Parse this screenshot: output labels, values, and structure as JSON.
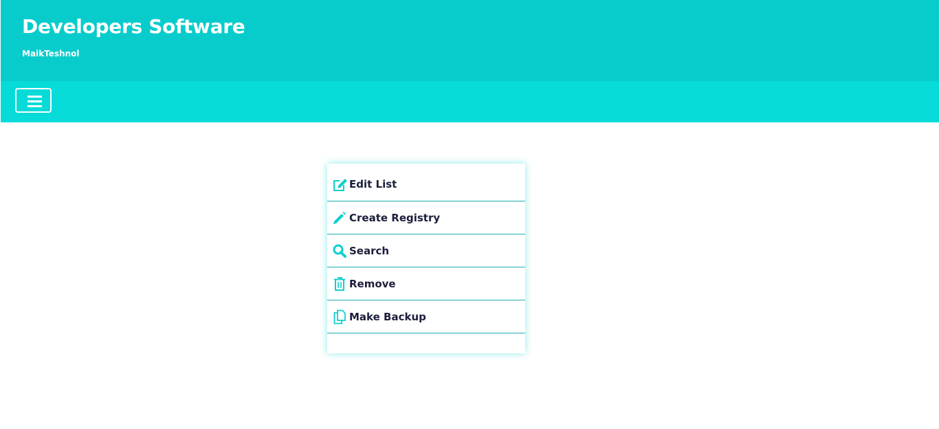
{
  "header": {
    "title": "Developers Software",
    "subtitle": "MaikTeshnol"
  },
  "navbar": {
    "menu_toggle_icon": "hamburger-icon"
  },
  "menu": {
    "items": [
      {
        "label": "Edit List",
        "icon": "edit-icon"
      },
      {
        "label": "Create Registry",
        "icon": "pencil-icon"
      },
      {
        "label": "Search",
        "icon": "search-icon"
      },
      {
        "label": "Remove",
        "icon": "trash-icon"
      },
      {
        "label": "Make Backup",
        "icon": "copy-icon"
      }
    ]
  },
  "colors": {
    "header_bg": "#08cccc",
    "navbar_bg": "#06dbd9",
    "accent": "#0fcfcf",
    "text_dark": "#1b1f3b"
  }
}
